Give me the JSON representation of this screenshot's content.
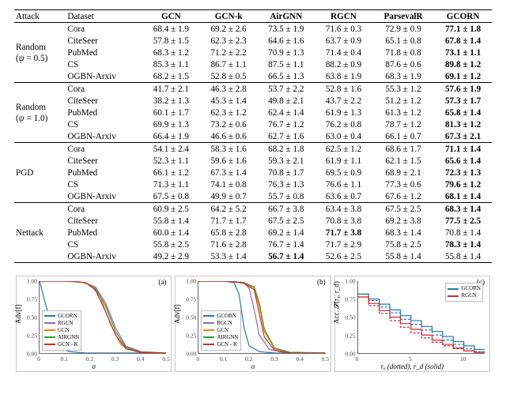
{
  "table": {
    "headers": [
      "Attack",
      "Dataset",
      "GCN",
      "GCN-k",
      "AirGNN",
      "RGCN",
      "ParsevalR",
      "GCORN"
    ],
    "sections": [
      {
        "attack_name": "Random",
        "attack_sub": "(ψ = 0.5)",
        "rows": [
          {
            "dataset": "Cora",
            "cells": [
              "68.4 ± 1.9",
              "69.2 ± 2.6",
              "73.5 ± 1.9",
              "71.6 ± 0.3",
              "72.9 ± 0.9",
              "77.1 ± 1.8"
            ],
            "bold": [
              5
            ]
          },
          {
            "dataset": "CiteSeer",
            "cells": [
              "57.8 ± 1.5",
              "62.3 ± 2.3",
              "64.6 ± 1.6",
              "63.7 ± 0.9",
              "65.1 ± 0.8",
              "67.8 ± 1.4"
            ],
            "bold": [
              5
            ]
          },
          {
            "dataset": "PubMed",
            "cells": [
              "68.3 ± 1.2",
              "71.2 ± 2.2",
              "70.9 ± 1.3",
              "71.4 ± 0.4",
              "71.8 ± 0.8",
              "73.1 ± 1.1"
            ],
            "bold": [
              5
            ]
          },
          {
            "dataset": "CS",
            "cells": [
              "85.3 ± 1.1",
              "86.7 ± 1.1",
              "87.5 ± 1.1",
              "88.2 ± 0.9",
              "87.6 ± 0.6",
              "89.8 ± 1.2"
            ],
            "bold": [
              5
            ]
          },
          {
            "dataset": "OGBN-Arxiv",
            "cells": [
              "68.2 ± 1.5",
              "52.8 ± 0.5",
              "66.5 ± 1.3",
              "63.8 ± 1.9",
              "68.3 ± 1.9",
              "69.1 ± 1.2"
            ],
            "bold": [
              5
            ]
          }
        ]
      },
      {
        "attack_name": "Random",
        "attack_sub": "(ψ = 1.0)",
        "rows": [
          {
            "dataset": "Cora",
            "cells": [
              "41.7 ± 2.1",
              "46.3 ± 2.8",
              "53.7 ± 2.2",
              "52.8 ± 1.6",
              "55.3 ± 1.2",
              "57.6 ± 1.9"
            ],
            "bold": [
              5
            ]
          },
          {
            "dataset": "CiteSeer",
            "cells": [
              "38.2 ± 1.3",
              "45.3 ± 1.4",
              "49.8 ± 2.1",
              "43.7 ± 2.2",
              "51.2 ± 1.2",
              "57.3 ± 1.7"
            ],
            "bold": [
              5
            ]
          },
          {
            "dataset": "PubMed",
            "cells": [
              "60.1 ± 1.7",
              "62.3 ± 1.2",
              "62.4 ± 1.4",
              "61.9 ± 1.3",
              "61.3 ± 1.2",
              "65.8 ± 1.4"
            ],
            "bold": [
              5
            ]
          },
          {
            "dataset": "CS",
            "cells": [
              "69.9 ± 1.3",
              "73.2 ± 0.6",
              "76.7 ± 1.2",
              "76.2 ± 0.8",
              "78.7 ± 1.2",
              "81.3 ± 1.2"
            ],
            "bold": [
              5
            ]
          },
          {
            "dataset": "OGBN-Arxiv",
            "cells": [
              "66.4 ± 1.9",
              "46.6 ± 0.6",
              "62.7 ± 1.6",
              "63.0 ± 0.4",
              "66.1 ± 0.7",
              "67.3 ± 2.1"
            ],
            "bold": [
              5
            ]
          }
        ]
      },
      {
        "attack_name": "PGD",
        "attack_sub": "",
        "rows": [
          {
            "dataset": "Cora",
            "cells": [
              "54.1 ± 2.4",
              "58.3 ± 1.6",
              "68.2 ± 1.8",
              "62.5 ± 1.2",
              "68.6 ± 1.7",
              "71.1 ± 1.4"
            ],
            "bold": [
              5
            ]
          },
          {
            "dataset": "CiteSeer",
            "cells": [
              "52.3 ± 1.1",
              "59.6 ± 1.6",
              "59.3 ± 2.1",
              "61.9 ± 1.1",
              "62.1 ± 1.5",
              "65.6 ± 1.4"
            ],
            "bold": [
              5
            ]
          },
          {
            "dataset": "PubMed",
            "cells": [
              "66.1 ± 1.2",
              "67.3 ± 1.4",
              "70.8 ± 1.7",
              "69.5 ± 0.9",
              "68.9 ± 2.1",
              "72.3 ± 1.3"
            ],
            "bold": [
              5
            ]
          },
          {
            "dataset": "CS",
            "cells": [
              "71.3 ± 1.1",
              "74.1 ± 0.8",
              "76.3 ± 1.3",
              "76.6 ± 1.1",
              "77.3 ± 0.6",
              "79.6 ± 1.2"
            ],
            "bold": [
              5
            ]
          },
          {
            "dataset": "OGBN-Arxiv",
            "cells": [
              "67.5 ± 0.8",
              "49.9 ± 0.7",
              "55.7 ± 0.8",
              "63.6 ± 0.7",
              "67.6 ± 1.2",
              "68.1 ± 1.4"
            ],
            "bold": [
              5
            ]
          }
        ]
      },
      {
        "attack_name": "Nettack",
        "attack_sub": "",
        "rows": [
          {
            "dataset": "Cora",
            "cells": [
              "60.9 ± 2.5",
              "64.2 ± 5.2",
              "66.7 ± 3.8",
              "63.4 ± 3.8",
              "67.5 ± 2.5",
              "68.3 ± 1.4"
            ],
            "bold": [
              5
            ]
          },
          {
            "dataset": "CiteSeer",
            "cells": [
              "55.8 ± 1.4",
              "71.7 ± 1.7",
              "67.5 ± 2.5",
              "70.8 ± 3.8",
              "69.2 ± 3.8",
              "77.5 ± 2.5"
            ],
            "bold": [
              5
            ]
          },
          {
            "dataset": "PubMed",
            "cells": [
              "60.0 ± 1.4",
              "65.8 ± 2.8",
              "69.2 ± 1.4",
              "71.7 ± 3.8",
              "68.3 ± 1.4",
              "70.8 ± 1.4"
            ],
            "bold": [
              3
            ]
          },
          {
            "dataset": "CS",
            "cells": [
              "55.8 ± 2.5",
              "71.6 ± 2.8",
              "76.7 ± 1.4",
              "71.7 ± 2.9",
              "75.8 ± 2.5",
              "78.3 ± 1.4"
            ],
            "bold": [
              5
            ]
          },
          {
            "dataset": "OGBN-Arxiv",
            "cells": [
              "49.2 ± 2.9",
              "53.3 ± 1.4",
              "56.7 ± 1.4",
              "52.6 ± 2.5",
              "55.8 ± 1.4",
              "55.8 ± 1.4"
            ],
            "bold": [
              2
            ]
          }
        ]
      }
    ]
  },
  "chart_data": [
    {
      "type": "line",
      "tag": "(a)",
      "xlabel": "σ",
      "ylabel": "Adv[f]",
      "xlim": [
        0.0,
        0.5
      ],
      "ylim": [
        0.0,
        1.0
      ],
      "xticks": [
        0.0,
        0.1,
        0.2,
        0.3,
        0.4,
        0.5
      ],
      "yticks": [
        0.0,
        0.25,
        0.5,
        0.75,
        1.0
      ],
      "legend_pos": "bottom-left",
      "series": [
        {
          "name": "GCORN",
          "color": "#1f77b4",
          "x": [
            0.0,
            0.03,
            0.06,
            0.09,
            0.12,
            0.18,
            0.22,
            0.25,
            0.3,
            0.4,
            0.5
          ],
          "y": [
            1.0,
            0.6,
            0.15,
            0.05,
            0.02,
            0.0,
            0.0,
            0.0,
            0.0,
            0.0,
            0.0
          ]
        },
        {
          "name": "RGCN",
          "color": "#9467bd",
          "x": [
            0.0,
            0.1,
            0.18,
            0.22,
            0.26,
            0.3,
            0.34,
            0.4,
            0.5
          ],
          "y": [
            1.0,
            1.0,
            0.98,
            0.92,
            0.7,
            0.35,
            0.1,
            0.02,
            0.0
          ]
        },
        {
          "name": "GCN",
          "color": "#ff7f0e",
          "x": [
            0.0,
            0.1,
            0.16,
            0.2,
            0.24,
            0.28,
            0.32,
            0.38,
            0.5
          ],
          "y": [
            1.0,
            1.0,
            0.99,
            0.95,
            0.78,
            0.4,
            0.12,
            0.02,
            0.0
          ]
        },
        {
          "name": "AIRGNN",
          "color": "#2ca02c",
          "x": [
            0.0,
            0.12,
            0.18,
            0.22,
            0.26,
            0.3,
            0.34,
            0.4,
            0.5
          ],
          "y": [
            1.0,
            1.0,
            0.98,
            0.9,
            0.66,
            0.3,
            0.08,
            0.01,
            0.0
          ]
        },
        {
          "name": "GCN - K",
          "color": "#d62728",
          "x": [
            0.0,
            0.12,
            0.18,
            0.22,
            0.26,
            0.3,
            0.34,
            0.4,
            0.5
          ],
          "y": [
            1.0,
            1.0,
            0.98,
            0.88,
            0.58,
            0.25,
            0.06,
            0.01,
            0.0
          ]
        }
      ]
    },
    {
      "type": "line",
      "tag": "(b)",
      "xlabel": "σ",
      "ylabel": "Adv[f]",
      "xlim": [
        0.0,
        0.5
      ],
      "ylim": [
        0.0,
        1.0
      ],
      "xticks": [
        0.0,
        0.1,
        0.2,
        0.3,
        0.4,
        0.5
      ],
      "yticks": [
        0.0,
        0.25,
        0.5,
        0.75,
        1.0
      ],
      "legend_pos": "bottom-left",
      "series": [
        {
          "name": "GCORN",
          "color": "#1f77b4",
          "x": [
            0.0,
            0.1,
            0.14,
            0.16,
            0.18,
            0.2,
            0.24,
            0.3,
            0.4,
            0.5
          ],
          "y": [
            1.0,
            1.0,
            0.98,
            0.82,
            0.35,
            0.1,
            0.02,
            0.0,
            0.0,
            0.0
          ]
        },
        {
          "name": "RGCN",
          "color": "#9467bd",
          "x": [
            0.0,
            0.12,
            0.18,
            0.2,
            0.22,
            0.24,
            0.28,
            0.35,
            0.5
          ],
          "y": [
            1.0,
            1.0,
            0.98,
            0.9,
            0.6,
            0.25,
            0.05,
            0.0,
            0.0
          ]
        },
        {
          "name": "GCN",
          "color": "#ff7f0e",
          "x": [
            0.0,
            0.12,
            0.18,
            0.22,
            0.24,
            0.26,
            0.3,
            0.36,
            0.5
          ],
          "y": [
            1.0,
            1.0,
            0.98,
            0.9,
            0.65,
            0.3,
            0.06,
            0.01,
            0.0
          ]
        },
        {
          "name": "AIRGNN",
          "color": "#2ca02c",
          "x": [
            0.0,
            0.12,
            0.18,
            0.22,
            0.24,
            0.26,
            0.3,
            0.36,
            0.5
          ],
          "y": [
            1.0,
            1.0,
            0.98,
            0.92,
            0.7,
            0.33,
            0.07,
            0.01,
            0.0
          ]
        },
        {
          "name": "GCN - K",
          "color": "#d62728",
          "x": [
            0.0,
            0.12,
            0.18,
            0.22,
            0.24,
            0.26,
            0.3,
            0.36,
            0.5
          ],
          "y": [
            1.0,
            1.0,
            0.97,
            0.88,
            0.55,
            0.22,
            0.04,
            0.0,
            0.0
          ]
        }
      ]
    },
    {
      "type": "line",
      "tag": "(c)",
      "xlabel": "rₐ (dotted), r_d (solid)",
      "ylabel": "Acc. 𝓢(rₐ, r_d)",
      "xlim": [
        0,
        12
      ],
      "ylim": [
        0.0,
        1.0
      ],
      "xticks": [
        0,
        5,
        10
      ],
      "yticks": [
        0.0,
        0.25,
        0.5,
        0.75,
        1.0
      ],
      "legend_pos": "top-right",
      "series": [
        {
          "name": "GCORN",
          "color": "#1f77b4",
          "dash": "3,2",
          "x": [
            0,
            1,
            1,
            2,
            2,
            3,
            3,
            4,
            4,
            5,
            5,
            6,
            6,
            7,
            7,
            8,
            8,
            9,
            9,
            10,
            10,
            11,
            11,
            12
          ],
          "y": [
            0.82,
            0.82,
            0.73,
            0.73,
            0.64,
            0.64,
            0.56,
            0.56,
            0.47,
            0.47,
            0.4,
            0.4,
            0.32,
            0.32,
            0.25,
            0.25,
            0.18,
            0.18,
            0.12,
            0.12,
            0.06,
            0.06,
            0.02,
            0.02
          ]
        },
        {
          "name": "GCORN",
          "color": "#1f77b4",
          "dash": "",
          "x": [
            0,
            1,
            1,
            2,
            2,
            3,
            3,
            4,
            4,
            5,
            5,
            6,
            6,
            7,
            7,
            8,
            8,
            9,
            9,
            10,
            10,
            11,
            11,
            12
          ],
          "y": [
            0.82,
            0.82,
            0.75,
            0.75,
            0.68,
            0.68,
            0.6,
            0.6,
            0.52,
            0.52,
            0.45,
            0.45,
            0.37,
            0.37,
            0.3,
            0.3,
            0.23,
            0.23,
            0.16,
            0.16,
            0.1,
            0.1,
            0.05,
            0.05
          ]
        },
        {
          "name": "RGCN",
          "color": "#d62728",
          "dash": "3,2",
          "x": [
            0,
            1,
            1,
            2,
            2,
            3,
            3,
            4,
            4,
            5,
            5,
            6,
            6,
            7,
            7,
            8,
            8,
            9,
            9,
            10,
            10,
            11,
            11,
            12
          ],
          "y": [
            0.78,
            0.78,
            0.66,
            0.66,
            0.55,
            0.55,
            0.45,
            0.45,
            0.36,
            0.36,
            0.28,
            0.28,
            0.21,
            0.21,
            0.15,
            0.15,
            0.1,
            0.1,
            0.06,
            0.06,
            0.03,
            0.03,
            0.01,
            0.01
          ]
        },
        {
          "name": "RGCN",
          "color": "#d62728",
          "dash": "",
          "x": [
            0,
            1,
            1,
            2,
            2,
            3,
            3,
            4,
            4,
            5,
            5,
            6,
            6,
            7,
            7,
            8,
            8,
            9,
            9,
            10,
            10,
            11,
            11,
            12
          ],
          "y": [
            0.78,
            0.78,
            0.69,
            0.69,
            0.59,
            0.59,
            0.5,
            0.5,
            0.41,
            0.41,
            0.33,
            0.33,
            0.25,
            0.25,
            0.18,
            0.18,
            0.12,
            0.12,
            0.07,
            0.07,
            0.03,
            0.03,
            0.01,
            0.01
          ]
        }
      ],
      "legend_entries": [
        {
          "name": "GCORN",
          "color": "#1f77b4"
        },
        {
          "name": "RGCN",
          "color": "#d62728"
        }
      ]
    }
  ]
}
